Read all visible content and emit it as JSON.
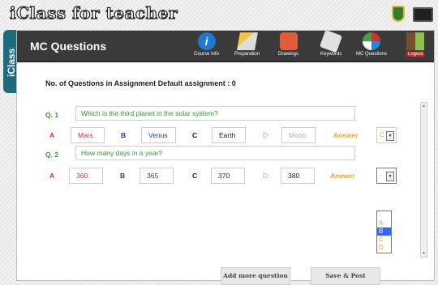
{
  "app": {
    "logo_text": "iClass for teacher",
    "side_tab": "iClass"
  },
  "header": {
    "title": "MC Questions",
    "nav": [
      {
        "label": "Course Info",
        "icon": "info-icon"
      },
      {
        "label": "Preparation",
        "icon": "preparation-icon"
      },
      {
        "label": "Drawings",
        "icon": "drawings-icon"
      },
      {
        "label": "Keywords",
        "icon": "keywords-icon"
      },
      {
        "label": "MC Questions",
        "icon": "mc-questions-icon"
      },
      {
        "label": "Logout",
        "icon": "logout-icon"
      }
    ]
  },
  "assignment": {
    "info": "No. of Questions in Assignment Default assignment  :  0"
  },
  "questions": [
    {
      "label": "Q. 1",
      "text": "Which is the third planet in the solar system?",
      "options": [
        {
          "letter": "A",
          "value": "Mars"
        },
        {
          "letter": "B",
          "value": "Venus"
        },
        {
          "letter": "C",
          "value": "Earth"
        },
        {
          "letter": "D",
          "value": "Moon"
        }
      ],
      "answer_label": "Answer",
      "answer": "C"
    },
    {
      "label": "Q. 2",
      "text": "How many days in a year?",
      "options": [
        {
          "letter": "A",
          "value": "360"
        },
        {
          "letter": "B",
          "value": "365"
        },
        {
          "letter": "C",
          "value": "370"
        },
        {
          "letter": "D",
          "value": "380"
        }
      ],
      "answer_label": "Answer",
      "answer": "-"
    }
  ],
  "answer_dropdown": {
    "options": [
      "-",
      "A",
      "B",
      "C",
      "D"
    ],
    "highlighted": "B"
  },
  "buttons": {
    "add_more": "Add more question",
    "save_post": "Save & Post"
  },
  "colors": {
    "header_bg": "#3a3a3a",
    "question_green": "#2a9c2a",
    "letter_a": "#d32f2f",
    "letter_b": "#1f3aa8",
    "answer_orange": "#f2a421",
    "highlight": "#3366ff"
  }
}
